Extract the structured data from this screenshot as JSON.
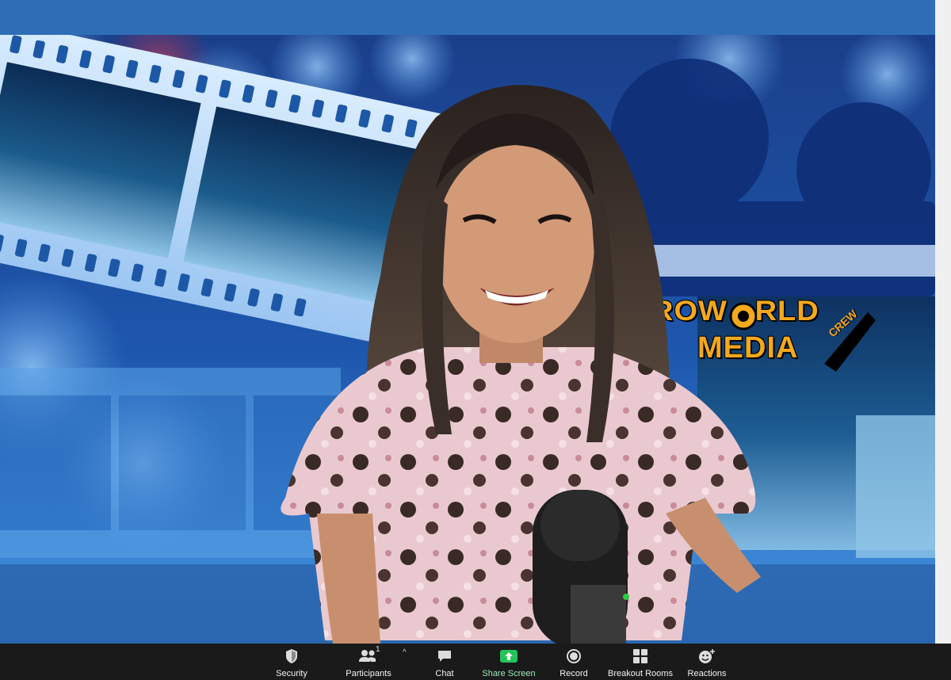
{
  "meeting": {
    "background": {
      "logo_line1": "ROW",
      "logo_line1b": "RLD",
      "logo_line2": "MEDIA",
      "logo_crew": "CREW"
    }
  },
  "toolbar": {
    "items": [
      {
        "label": "Security",
        "icon": "shield-icon"
      },
      {
        "label": "Participants",
        "icon": "participants-icon",
        "count": "1"
      },
      {
        "label": "Chat",
        "icon": "chat-icon"
      },
      {
        "label": "Share Screen",
        "icon": "share-screen-icon"
      },
      {
        "label": "Record",
        "icon": "record-icon"
      },
      {
        "label": "Breakout Rooms",
        "icon": "breakout-rooms-icon"
      },
      {
        "label": "Reactions",
        "icon": "reactions-icon"
      }
    ],
    "caret": "^",
    "colors": {
      "background": "#1a1a1a",
      "share_accent": "#23c45a",
      "label": "#ffffff"
    }
  }
}
